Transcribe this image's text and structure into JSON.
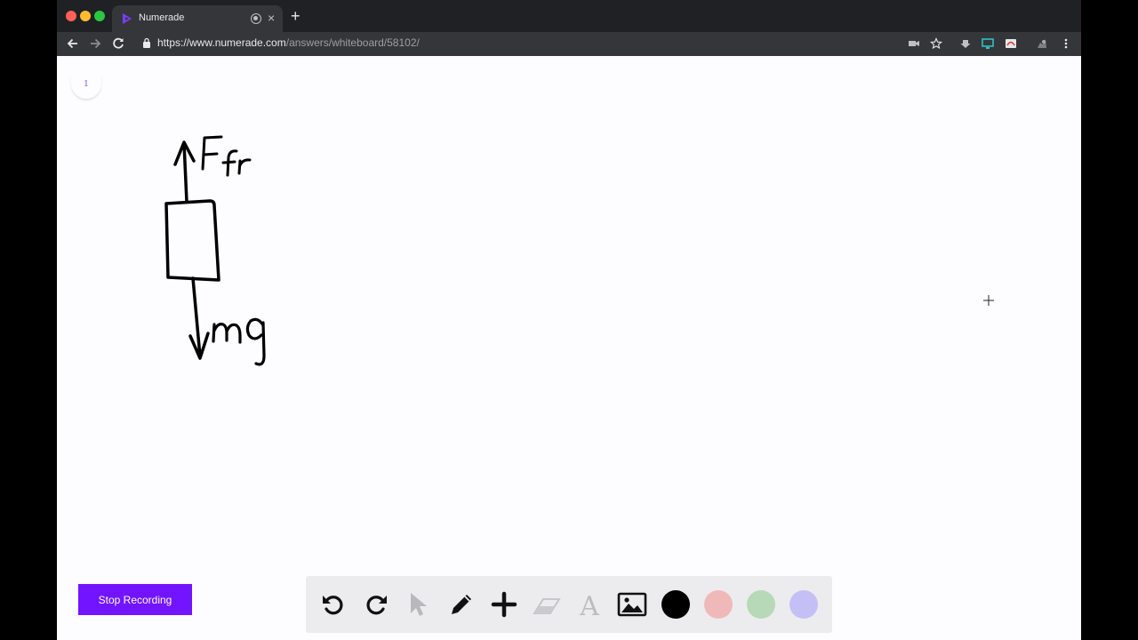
{
  "browser": {
    "tab_title": "Numerade",
    "url_host": "https://www.numerade.com",
    "url_path": "/answers/whiteboard/58102/"
  },
  "whiteboard": {
    "page_number": "1",
    "drawing_labels": {
      "upward_force": "Ffr",
      "downward_force": "mg"
    }
  },
  "actions": {
    "stop_recording_label": "Stop Recording"
  },
  "toolbar": {
    "tools": [
      "undo",
      "redo",
      "select",
      "pen",
      "add",
      "eraser",
      "text",
      "image"
    ],
    "colors": [
      "#000000",
      "#f0b9b9",
      "#b7d9b8",
      "#c4c0f5"
    ],
    "selected_color": "#000000"
  }
}
